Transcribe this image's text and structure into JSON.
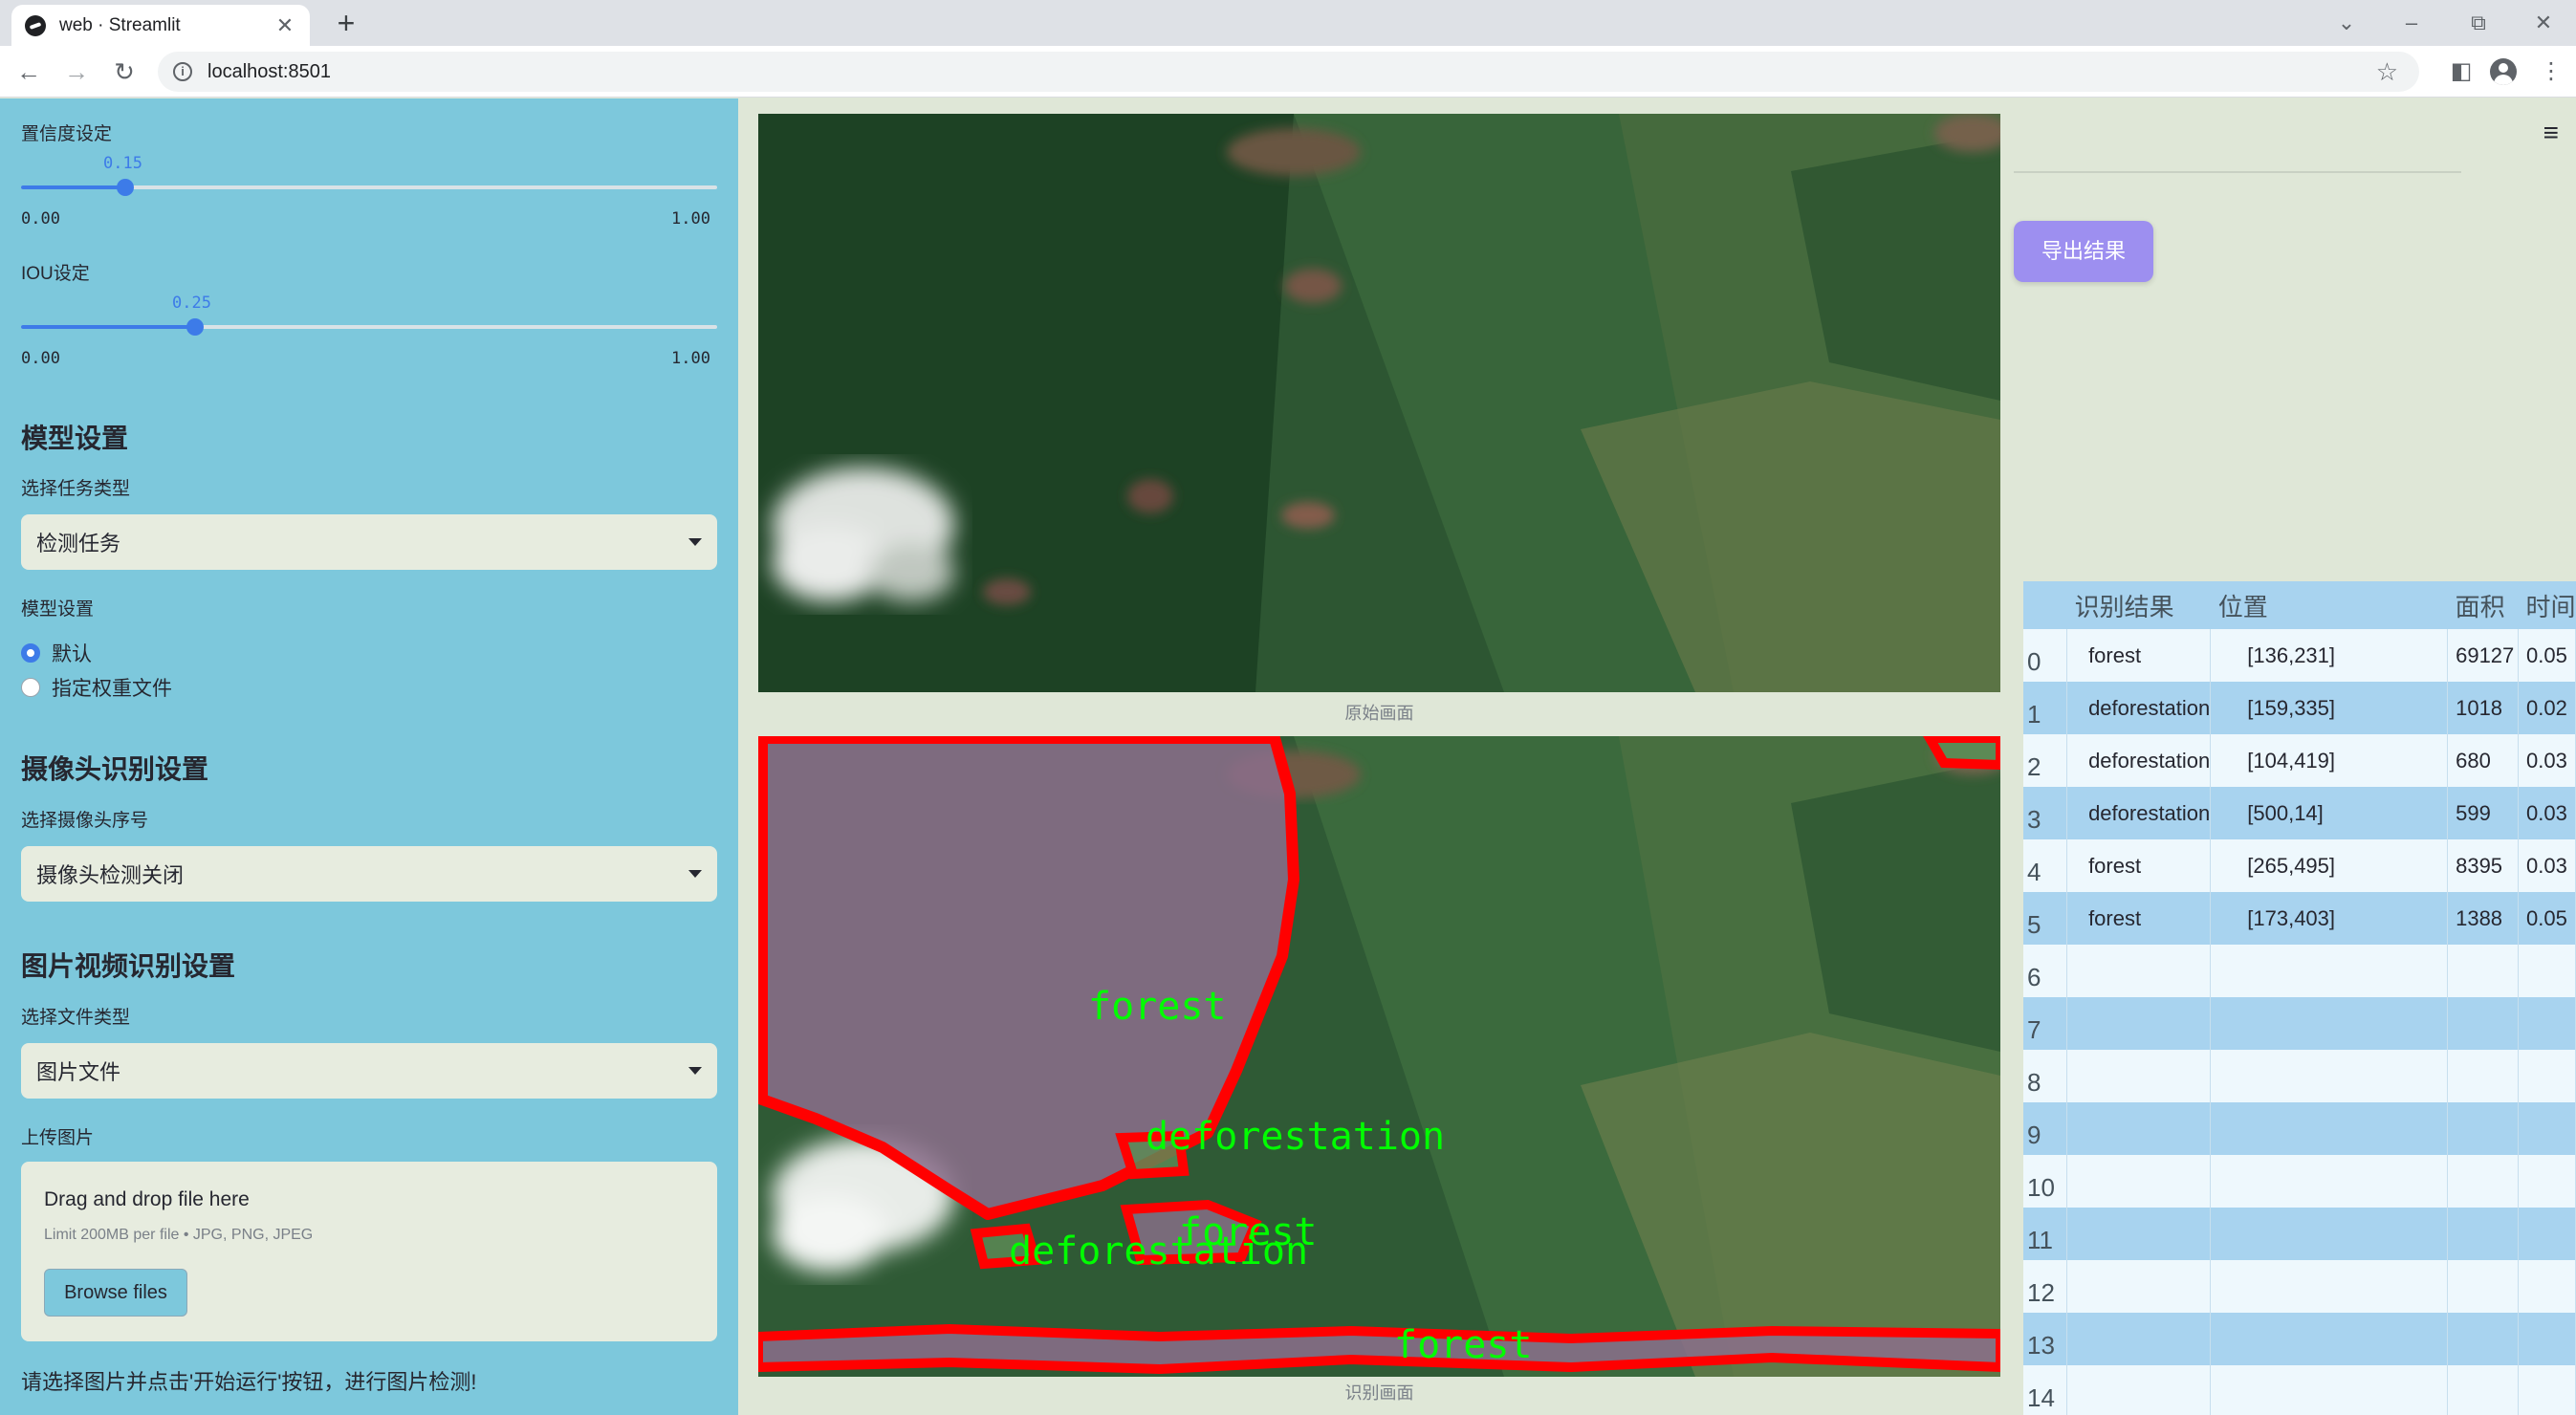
{
  "browser": {
    "tab_title": "web · Streamlit",
    "tab_close": "✕",
    "new_tab": "+",
    "url": "localhost:8501",
    "controls": {
      "collapse": "⌄",
      "minimize": "–",
      "restore": "⧉",
      "close": "✕"
    }
  },
  "sidebar": {
    "confidence": {
      "label": "置信度设定",
      "value": "0.15",
      "min": "0.00",
      "max": "1.00",
      "level": 0.15
    },
    "iou": {
      "label": "IOU设定",
      "value": "0.25",
      "min": "0.00",
      "max": "1.00",
      "level": 0.25
    },
    "model_heading": "模型设置",
    "task_label": "选择任务类型",
    "task_value": "检测任务",
    "model_label": "模型设置",
    "model_options": [
      "默认",
      "指定权重文件"
    ],
    "camera_heading": "摄像头识别设置",
    "camera_label": "选择摄像头序号",
    "camera_value": "摄像头检测关闭",
    "media_heading": "图片视频识别设置",
    "file_type_label": "选择文件类型",
    "file_type_value": "图片文件",
    "upload_label": "上传图片",
    "upload_title": "Drag and drop file here",
    "upload_limit": "Limit 200MB per file • JPG, PNG, JPEG",
    "browse_label": "Browse files",
    "footer": "请选择图片并点击'开始运行'按钮，进行图片检测!"
  },
  "main": {
    "original_caption": "原始画面",
    "detected_caption": "识别画面",
    "detections_overlay": [
      {
        "label": "forest"
      },
      {
        "label": "deforestation"
      },
      {
        "label": "forest"
      },
      {
        "label": "deforestation"
      },
      {
        "label": "forest"
      }
    ]
  },
  "results": {
    "menu_icon": "≡",
    "export_label": "导出结果",
    "columns": [
      "",
      "识别结果",
      "位置",
      "面积",
      "时间"
    ],
    "rows": [
      {
        "idx": "0",
        "cls": "forest",
        "pos": "[136,231]",
        "area": "69127",
        "time": "0.05"
      },
      {
        "idx": "1",
        "cls": "deforestation",
        "pos": "[159,335]",
        "area": "1018",
        "time": "0.02"
      },
      {
        "idx": "2",
        "cls": "deforestation",
        "pos": "[104,419]",
        "area": "680",
        "time": "0.03"
      },
      {
        "idx": "3",
        "cls": "deforestation",
        "pos": "[500,14]",
        "area": "599",
        "time": "0.03"
      },
      {
        "idx": "4",
        "cls": "forest",
        "pos": "[265,495]",
        "area": "8395",
        "time": "0.03"
      },
      {
        "idx": "5",
        "cls": "forest",
        "pos": "[173,403]",
        "area": "1388",
        "time": "0.05"
      },
      {
        "idx": "6",
        "cls": "",
        "pos": "",
        "area": "",
        "time": ""
      },
      {
        "idx": "7",
        "cls": "",
        "pos": "",
        "area": "",
        "time": ""
      },
      {
        "idx": "8",
        "cls": "",
        "pos": "",
        "area": "",
        "time": ""
      },
      {
        "idx": "9",
        "cls": "",
        "pos": "",
        "area": "",
        "time": ""
      },
      {
        "idx": "10",
        "cls": "",
        "pos": "",
        "area": "",
        "time": ""
      },
      {
        "idx": "11",
        "cls": "",
        "pos": "",
        "area": "",
        "time": ""
      },
      {
        "idx": "12",
        "cls": "",
        "pos": "",
        "area": "",
        "time": ""
      },
      {
        "idx": "13",
        "cls": "",
        "pos": "",
        "area": "",
        "time": ""
      },
      {
        "idx": "14",
        "cls": "",
        "pos": "",
        "area": "",
        "time": ""
      }
    ]
  }
}
